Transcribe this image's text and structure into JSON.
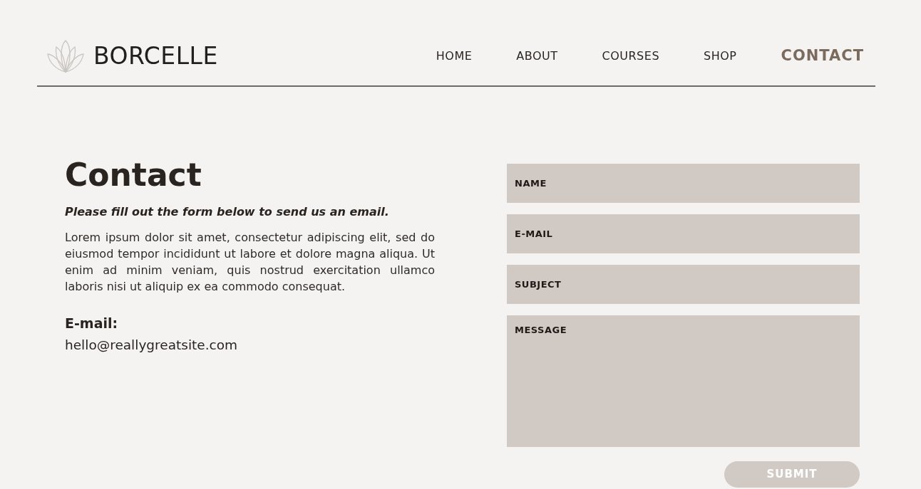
{
  "header": {
    "logo": {
      "text": "BORCELLE"
    },
    "nav": [
      {
        "label": "HOME",
        "selected": false
      },
      {
        "label": "ABOUT",
        "selected": false
      },
      {
        "label": "COURSES",
        "selected": false
      },
      {
        "label": "SHOP",
        "selected": false
      },
      {
        "label": "CONTACT",
        "selected": true
      }
    ]
  },
  "intro": {
    "title": "Contact",
    "subtitle": "Please fill out the form below to send us an email.",
    "body": "Lorem ipsum dolor sit amet, consectetur adipiscing elit, sed do eiusmod tempor incididunt ut labore et dolore magna aliqua. Ut enim ad minim veniam, quis nostrud exercitation ullamco laboris nisi ut aliquip ex ea commodo consequat.",
    "email_label": "E-mail:",
    "email": "hello@reallygreatsite.com"
  },
  "form": {
    "fields": [
      {
        "kind": "input",
        "placeholder": "NAME"
      },
      {
        "kind": "input",
        "placeholder": "E-MAIL"
      },
      {
        "kind": "input",
        "placeholder": "SUBJECT"
      },
      {
        "kind": "textarea",
        "placeholder": "MESSAGE"
      }
    ],
    "submit": "SUBMIT"
  }
}
